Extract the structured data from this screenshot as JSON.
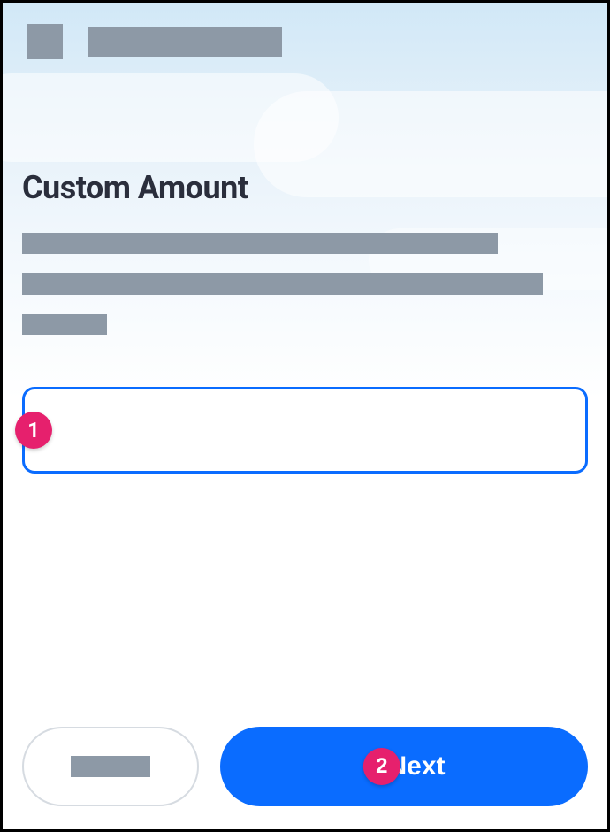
{
  "annotations": {
    "input_badge": "1",
    "next_badge": "2"
  },
  "header": {
    "icon_placeholder": "",
    "title_placeholder": ""
  },
  "page": {
    "heading": "Custom Amount"
  },
  "input": {
    "value": "",
    "placeholder": ""
  },
  "footer": {
    "secondary_label": "",
    "primary_label": "Next"
  }
}
